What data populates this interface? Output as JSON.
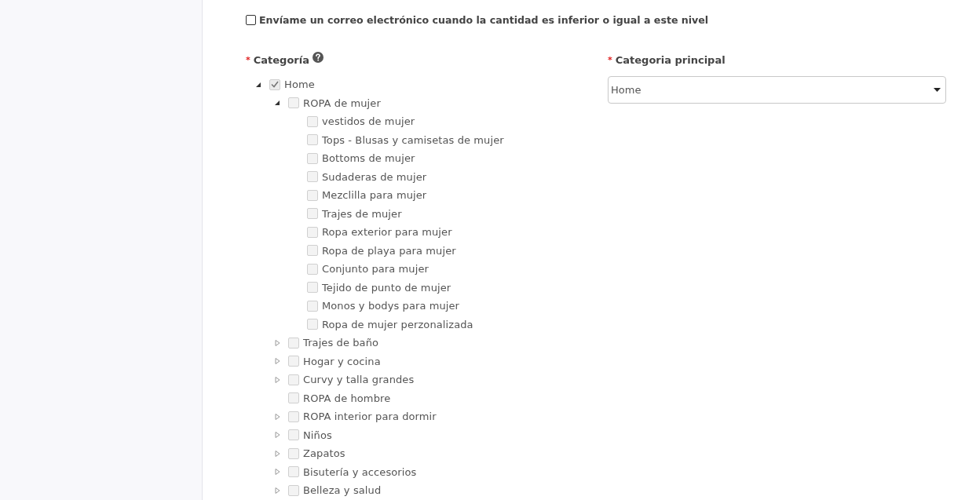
{
  "notify": {
    "label": "Envíame un correo electrónico cuando la cantidad es inferior o igual a este nivel",
    "checked": false
  },
  "category": {
    "required_mark": "*",
    "label": "Categoría",
    "tree": [
      {
        "label": "Home",
        "kind": "folder",
        "expanded": true,
        "checked": true,
        "children": [
          {
            "label": "ROPA de mujer",
            "kind": "folder",
            "expanded": true,
            "checked": false,
            "children": [
              {
                "label": "vestidos de mujer",
                "kind": "leaf",
                "checked": false
              },
              {
                "label": "Tops - Blusas y camisetas de mujer",
                "kind": "leaf",
                "checked": false
              },
              {
                "label": "Bottoms de mujer",
                "kind": "leaf",
                "checked": false
              },
              {
                "label": "Sudaderas de mujer",
                "kind": "leaf",
                "checked": false
              },
              {
                "label": "Mezclilla para mujer",
                "kind": "leaf",
                "checked": false
              },
              {
                "label": "Trajes de mujer",
                "kind": "leaf",
                "checked": false
              },
              {
                "label": "Ropa exterior para mujer",
                "kind": "leaf",
                "checked": false
              },
              {
                "label": "Ropa de playa para mujer",
                "kind": "leaf",
                "checked": false
              },
              {
                "label": "Conjunto para mujer",
                "kind": "leaf",
                "checked": false
              },
              {
                "label": "Tejido de punto de mujer",
                "kind": "leaf",
                "checked": false
              },
              {
                "label": "Monos y bodys para mujer",
                "kind": "leaf",
                "checked": false
              },
              {
                "label": "Ropa de mujer perzonalizada",
                "kind": "leaf",
                "checked": false
              }
            ]
          },
          {
            "label": "Trajes de baño",
            "kind": "folder",
            "expanded": false,
            "checked": false
          },
          {
            "label": "Hogar y cocina",
            "kind": "folder",
            "expanded": false,
            "checked": false
          },
          {
            "label": "Curvy y talla grandes",
            "kind": "folder",
            "expanded": false,
            "checked": false
          },
          {
            "label": "ROPA de hombre",
            "kind": "leaf",
            "checked": false
          },
          {
            "label": "ROPA interior para dormir",
            "kind": "folder",
            "expanded": false,
            "checked": false
          },
          {
            "label": "Niños",
            "kind": "folder",
            "expanded": false,
            "checked": false
          },
          {
            "label": "Zapatos",
            "kind": "folder",
            "expanded": false,
            "checked": false
          },
          {
            "label": "Bisutería y accesorios",
            "kind": "folder",
            "expanded": false,
            "checked": false
          },
          {
            "label": "Belleza y salud",
            "kind": "folder",
            "expanded": false,
            "checked": false
          }
        ]
      }
    ]
  },
  "main_category": {
    "required_mark": "*",
    "label": "Categoria principal",
    "value": "Home"
  }
}
